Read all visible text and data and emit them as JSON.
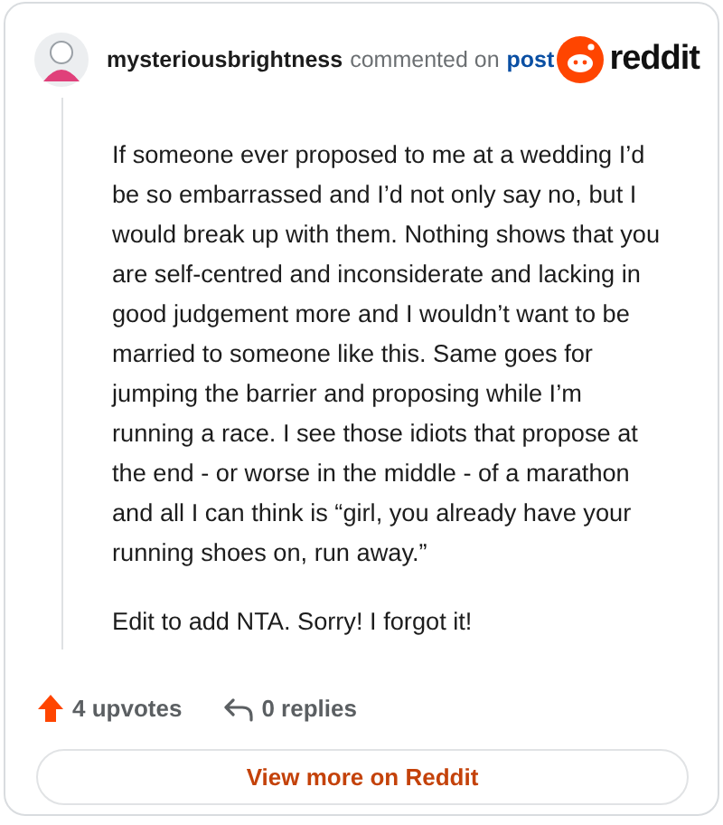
{
  "comment": {
    "author": "mysteriousbrightness",
    "action": "commented on",
    "link": "post",
    "brand": "reddit",
    "paragraphs": [
      "If someone ever proposed to me at a wedding I’d be so embarrassed and I’d not only say no, but I would break up with them. Nothing shows that you are self-centred and inconsiderate and lacking in good judgement more and I wouldn’t want to be married to someone like this. Same goes for jumping the barrier and proposing while I’m running a race. I see those idiots that propose at the end - or worse in the middle - of a marathon and all I can think is “girl, you already have your running shoes on, run away.”",
      "Edit to add NTA. Sorry! I forgot it!"
    ],
    "upvotes": "4 upvotes",
    "upvoted": true,
    "replies": "0 replies"
  },
  "button": "View more on Reddit"
}
